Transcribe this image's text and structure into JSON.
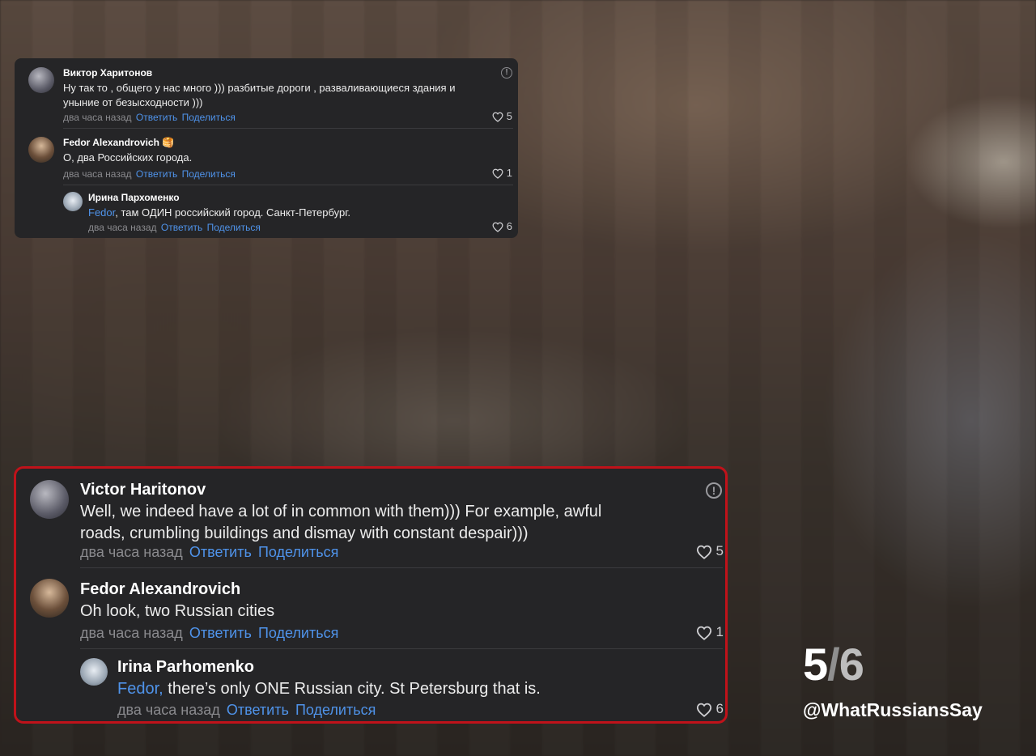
{
  "small_card": {
    "comments": [
      {
        "author": "Виктор Харитонов",
        "text": "Ну так то , общего у нас много ))) разбитые дороги , разваливающиеся здания и уныние от безысходности )))",
        "time": "два часа назад",
        "reply_label": "Ответить",
        "share_label": "Поделиться",
        "likes": "5"
      },
      {
        "author": "Fedor Alexandrovich 🥞",
        "text": "О, два Российских города.",
        "time": "два часа назад",
        "reply_label": "Ответить",
        "share_label": "Поделиться",
        "likes": "1"
      },
      {
        "author": "Ирина Пархоменко",
        "mention": "Fedor",
        "text": ", там ОДИН российский город. Санкт-Петербург.",
        "time": "два часа назад",
        "reply_label": "Ответить",
        "share_label": "Поделиться",
        "likes": "6"
      }
    ]
  },
  "large_card": {
    "comments": [
      {
        "author": "Victor Haritonov",
        "text": "Well, we indeed have a lot of in common with them))) For example, awful roads, crumbling buildings and dismay with constant despair)))",
        "time": "два часа назад",
        "reply_label": "Ответить",
        "share_label": "Поделиться",
        "likes": "5"
      },
      {
        "author": "Fedor Alexandrovich",
        "text": "Oh look, two Russian cities",
        "time": "два часа назад",
        "reply_label": "Ответить",
        "share_label": "Поделиться",
        "likes": "1"
      },
      {
        "author": "Irina Parhomenko",
        "mention": "Fedor,",
        "text": " there’s only ONE Russian city. St Petersburg that is.",
        "time": "два часа назад",
        "reply_label": "Ответить",
        "share_label": "Поделиться",
        "likes": "6"
      }
    ]
  },
  "overlay": {
    "page_current": "5",
    "page_separator": "/",
    "page_total": "6",
    "handle": "@WhatRussiansSay"
  },
  "colors": {
    "link": "#4f93ea",
    "highlight_border": "#c0121a",
    "card_bg": "#252527"
  },
  "icons": {
    "report": "info-circle-icon",
    "like": "heart-outline-icon"
  }
}
